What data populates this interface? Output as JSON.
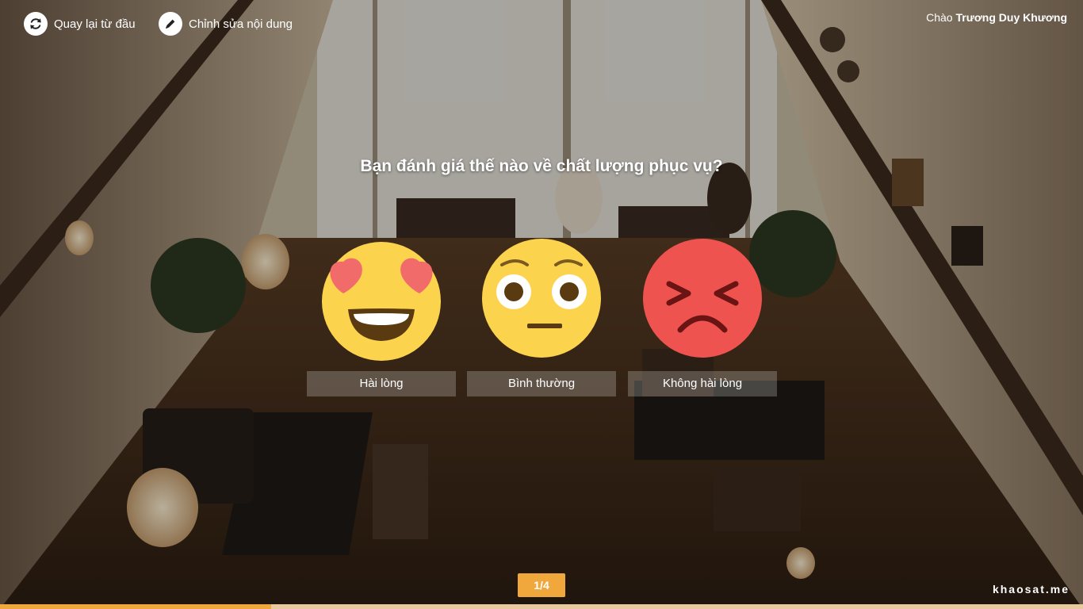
{
  "header": {
    "restart_label": "Quay lại từ đầu",
    "edit_label": "Chỉnh sửa nội dung",
    "greeting_prefix": "Chào",
    "user_name": "Trương Duy Khương"
  },
  "question": {
    "text": "Bạn đánh giá thế nào về chất lượng phục vụ?"
  },
  "options": [
    {
      "label": "Hài lòng",
      "icon": "heart-eyes-emoji-icon"
    },
    {
      "label": "Bình thường",
      "icon": "flushed-emoji-icon"
    },
    {
      "label": "Không hài lòng",
      "icon": "angry-emoji-icon"
    }
  ],
  "footer": {
    "page_indicator": "1/4",
    "brand": "khaosat.me",
    "progress_fraction": 0.25
  },
  "colors": {
    "accent": "#f0a83c",
    "emoji_yellow": "#fcd34d",
    "emoji_red": "#ef5350"
  }
}
